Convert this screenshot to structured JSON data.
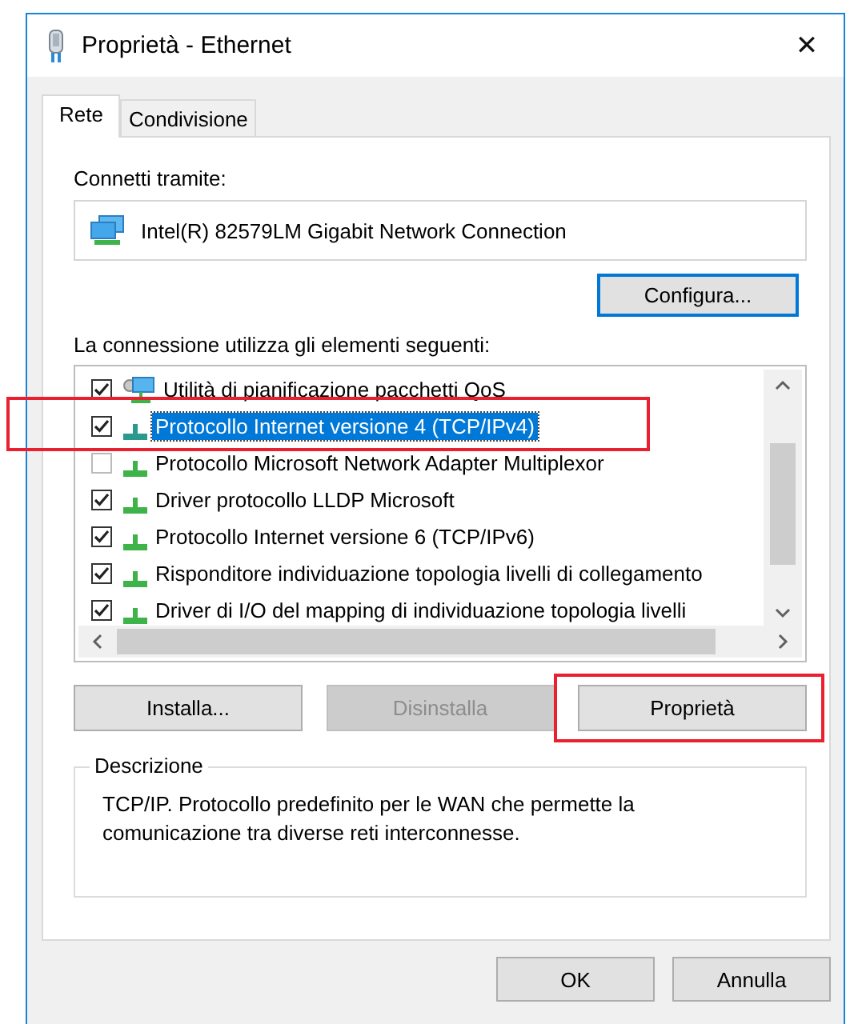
{
  "window": {
    "title": "Proprietà - Ethernet",
    "close": "✕"
  },
  "tabs": [
    {
      "label": "Rete",
      "selected": true
    },
    {
      "label": "Condivisione",
      "selected": false
    }
  ],
  "connect_label": "Connetti tramite:",
  "adapter": "Intel(R) 82579LM Gigabit Network Connection",
  "configure_button": {
    "label": "Configura...",
    "focused": true
  },
  "items_label": "La connessione utilizza gli elementi seguenti:",
  "items": [
    {
      "label": "Utilità di pianificazione pacchetti QoS",
      "checked": true,
      "selected": false,
      "highlighted": false,
      "kind": "service"
    },
    {
      "label": "Protocollo Internet versione 4 (TCP/IPv4)",
      "checked": true,
      "selected": true,
      "highlighted": true,
      "kind": "protocol"
    },
    {
      "label": "Protocollo Microsoft Network Adapter Multiplexor",
      "checked": false,
      "selected": false,
      "highlighted": false,
      "kind": "protocol"
    },
    {
      "label": "Driver protocollo LLDP Microsoft",
      "checked": true,
      "selected": false,
      "highlighted": false,
      "kind": "protocol"
    },
    {
      "label": "Protocollo Internet versione 6 (TCP/IPv6)",
      "checked": true,
      "selected": false,
      "highlighted": false,
      "kind": "protocol"
    },
    {
      "label": "Risponditore individuazione topologia livelli di collegamento",
      "checked": true,
      "selected": false,
      "highlighted": false,
      "kind": "protocol"
    },
    {
      "label": "Driver di I/O del mapping di individuazione topologia livelli",
      "checked": true,
      "selected": false,
      "highlighted": false,
      "kind": "protocol"
    }
  ],
  "action_buttons": [
    {
      "label": "Installa...",
      "disabled": false,
      "highlighted": false
    },
    {
      "label": "Disinstalla",
      "disabled": true,
      "highlighted": false
    },
    {
      "label": "Proprietà",
      "disabled": false,
      "highlighted": true
    }
  ],
  "description": {
    "title": "Descrizione",
    "text": "TCP/IP. Protocollo predefinito per le WAN che permette la comunicazione tra diverse reti interconnesse."
  },
  "dialog_buttons": [
    "OK",
    "Annulla"
  ]
}
